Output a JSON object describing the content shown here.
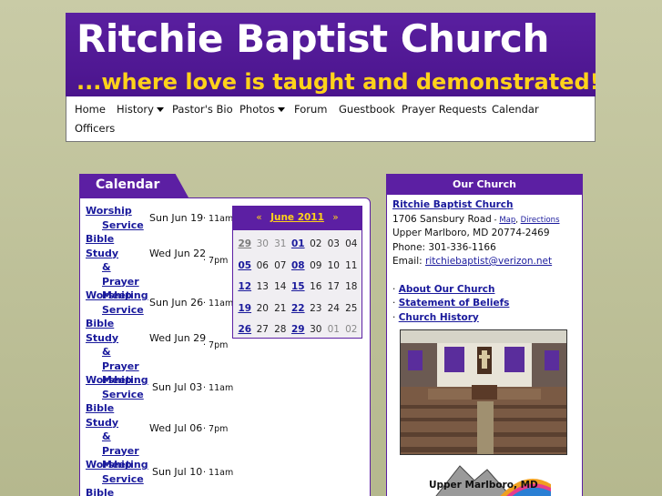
{
  "header": {
    "title": "Ritchie Baptist Church",
    "tagline": "...where love is taught and demonstrated!"
  },
  "nav": {
    "items": [
      {
        "label": "Home"
      },
      {
        "label": "History",
        "dropdown": true
      },
      {
        "label": "Pastor's Bio"
      },
      {
        "label": "Photos",
        "dropdown": true
      },
      {
        "label": "Forum"
      },
      {
        "label": "Guestbook"
      },
      {
        "label": "Prayer Requests"
      },
      {
        "label": "Calendar"
      },
      {
        "label": "Officers"
      }
    ]
  },
  "calendar": {
    "heading": "Calendar",
    "events": [
      {
        "title1": "Worship",
        "title2": "Service",
        "title3": "",
        "title4": "",
        "date": "Sun Jun 19",
        "time": "· 11am"
      },
      {
        "title1": "Bible Study",
        "title2": "&",
        "title3": "Prayer",
        "title4": "Meeting",
        "date": "Wed Jun 22",
        "time": "· 7pm"
      },
      {
        "title1": "Worship",
        "title2": "Service",
        "title3": "",
        "title4": "",
        "date": "Sun Jun 26",
        "time": "· 11am"
      },
      {
        "title1": "Bible Study",
        "title2": "&",
        "title3": "Prayer",
        "title4": "Meeting",
        "date": "Wed Jun 29",
        "time": "· 7pm"
      },
      {
        "title1": "Worship",
        "title2": "Service",
        "title3": "",
        "title4": "",
        "date": "Sun Jul 03",
        "time": "· 11am"
      },
      {
        "title1": "Bible Study",
        "title2": "&",
        "title3": "Prayer",
        "title4": "Meeting",
        "date": "Wed Jul 06",
        "time": "· 7pm"
      },
      {
        "title1": "Worship",
        "title2": "Service",
        "title3": "",
        "title4": "",
        "date": "Sun Jul 10",
        "time": "· 11am"
      },
      {
        "title1": "Bible Study",
        "title2": "",
        "title3": "",
        "title4": "",
        "date": "",
        "time": ""
      }
    ],
    "mini": {
      "prev": "«",
      "month": "June 2011",
      "next": "»",
      "weeks": [
        [
          {
            "d": "29",
            "o": true,
            "l": true
          },
          {
            "d": "30",
            "o": true
          },
          {
            "d": "31",
            "o": true
          },
          {
            "d": "01",
            "l": true
          },
          {
            "d": "02"
          },
          {
            "d": "03"
          },
          {
            "d": "04"
          }
        ],
        [
          {
            "d": "05",
            "l": true
          },
          {
            "d": "06"
          },
          {
            "d": "07"
          },
          {
            "d": "08",
            "l": true
          },
          {
            "d": "09"
          },
          {
            "d": "10"
          },
          {
            "d": "11"
          }
        ],
        [
          {
            "d": "12",
            "l": true
          },
          {
            "d": "13"
          },
          {
            "d": "14"
          },
          {
            "d": "15",
            "l": true
          },
          {
            "d": "16"
          },
          {
            "d": "17"
          },
          {
            "d": "18"
          }
        ],
        [
          {
            "d": "19",
            "l": true
          },
          {
            "d": "20"
          },
          {
            "d": "21"
          },
          {
            "d": "22",
            "l": true
          },
          {
            "d": "23"
          },
          {
            "d": "24"
          },
          {
            "d": "25"
          }
        ],
        [
          {
            "d": "26",
            "l": true
          },
          {
            "d": "27"
          },
          {
            "d": "28"
          },
          {
            "d": "29",
            "l": true
          },
          {
            "d": "30"
          },
          {
            "d": "01",
            "o": true
          },
          {
            "d": "02",
            "o": true
          }
        ]
      ]
    }
  },
  "church": {
    "heading": "Our Church",
    "name": "Ritchie Baptist Church",
    "street": "1706 Sansbury Road",
    "sep": " - ",
    "map": "Map",
    "comma": ", ",
    "directions": "Directions",
    "city": "Upper Marlboro, MD 20774-2469",
    "phone": "Phone: 301-336-1166",
    "email_label": "Email: ",
    "email": "ritchiebaptist@verizon.net",
    "links": [
      "About Our Church",
      "Statement of Beliefs",
      "Church History"
    ],
    "bullet": "·",
    "logo_text": "Upper Marlboro, MD"
  }
}
